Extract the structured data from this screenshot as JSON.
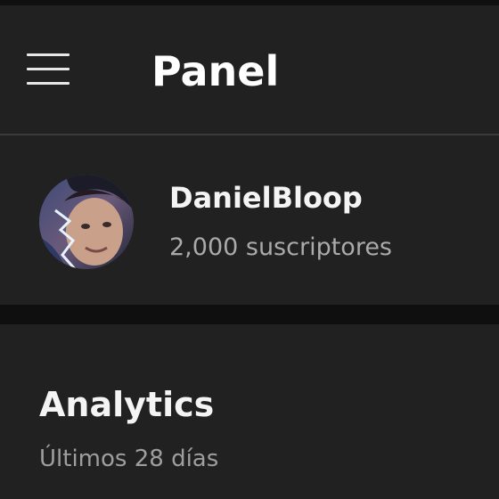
{
  "app_bar": {
    "title": "Panel",
    "menu_icon": "hamburger-menu-icon"
  },
  "channel": {
    "name": "DanielBloop",
    "subscribers": "2,000 suscriptores",
    "avatar": "channel-avatar-photo"
  },
  "analytics": {
    "title": "Analytics",
    "period": "Últimos 28 días"
  },
  "colors": {
    "background": "#181818",
    "card": "#212121",
    "primary_text": "#ffffff",
    "secondary_text": "#aaaaaa"
  }
}
